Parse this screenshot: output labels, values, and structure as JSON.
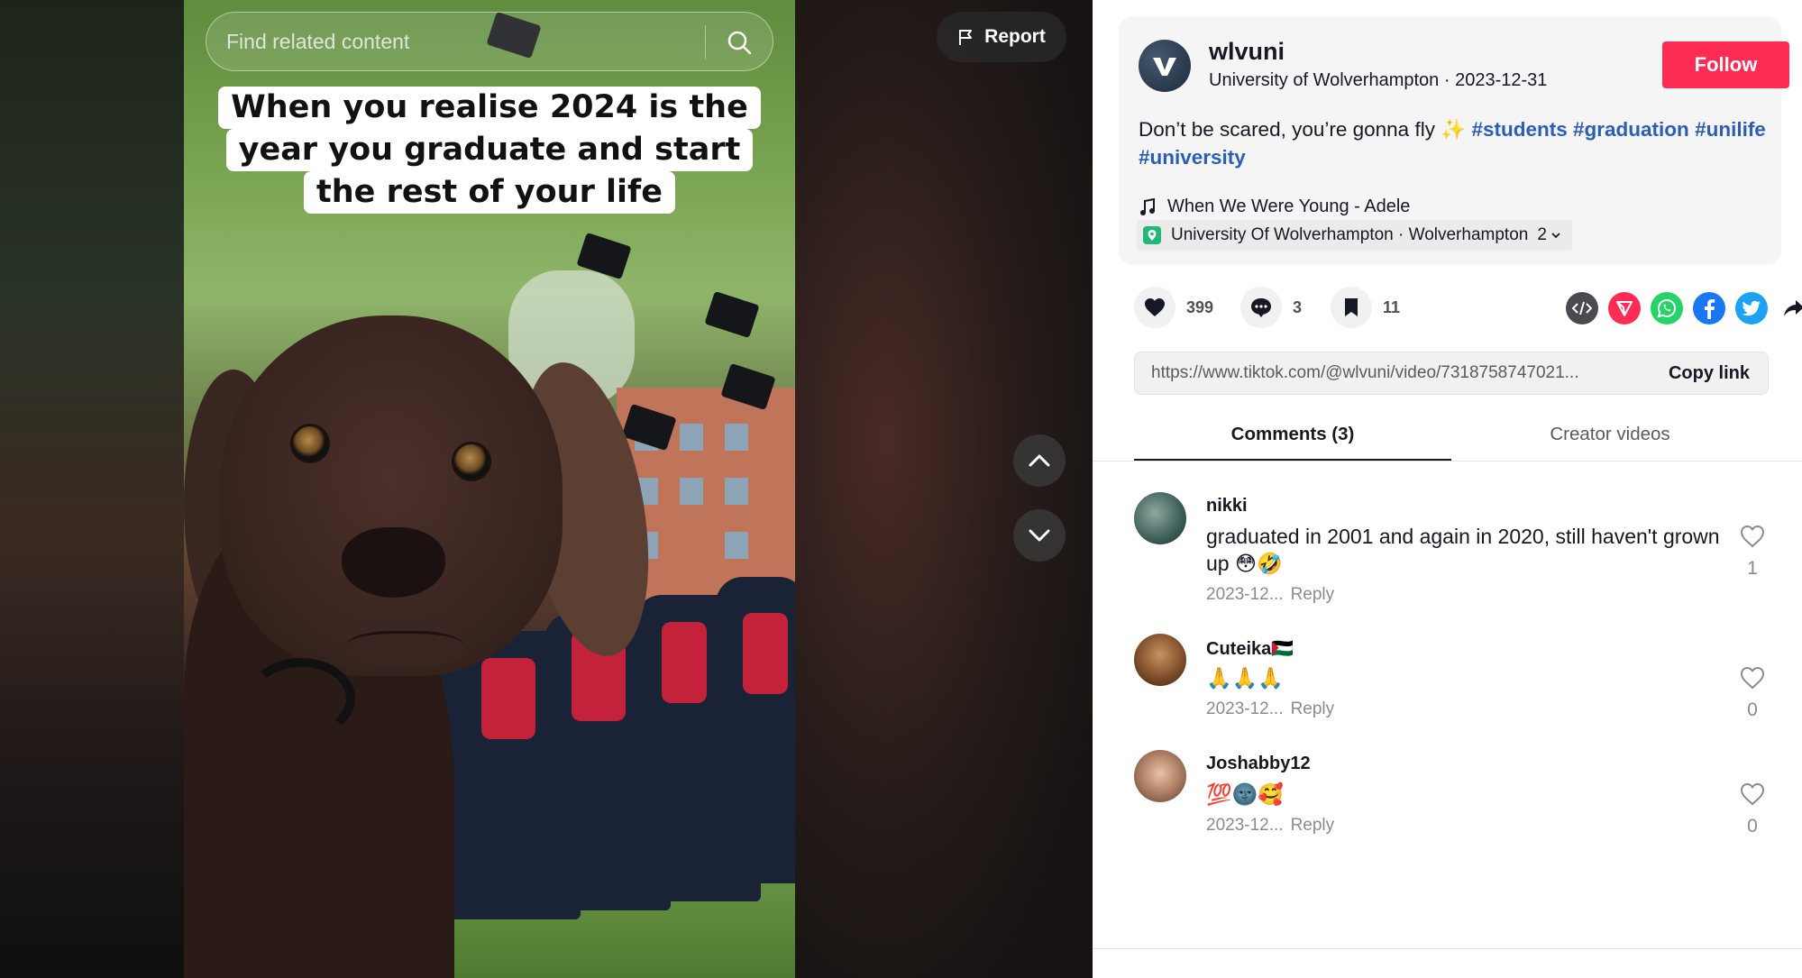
{
  "search": {
    "placeholder": "Find related content"
  },
  "report": {
    "label": "Report"
  },
  "video": {
    "caption_lines": [
      "When you realise 2024 is the",
      "year you graduate and start",
      "the rest of your life"
    ]
  },
  "author": {
    "username": "wlvuni",
    "display_name": "University of Wolverhampton",
    "separator": " · ",
    "date": "2023-12-31",
    "follow_label": "Follow"
  },
  "description": {
    "text": "Don’t be scared, you’re gonna fly ",
    "sparkle": "✨",
    "hashtags": [
      "#students",
      "#graduation",
      "#unilife",
      "#university"
    ]
  },
  "music": {
    "title": "When We Were Young - Adele"
  },
  "location": {
    "name": "University Of Wolverhampton · Wolverhampton",
    "extra_count": "2"
  },
  "actions": {
    "likes": "399",
    "comments": "3",
    "saves": "11",
    "share_icons": [
      "embed-icon",
      "send-icon",
      "whatsapp-icon",
      "facebook-icon",
      "twitter-icon",
      "share-arrow-icon"
    ]
  },
  "link": {
    "url": "https://www.tiktok.com/@wlvuni/video/7318758747021...",
    "copy_label": "Copy link"
  },
  "tabs": [
    {
      "label": "Comments (3)",
      "active": true
    },
    {
      "label": "Creator videos",
      "active": false
    }
  ],
  "comments": [
    {
      "user": "nikki",
      "text": "graduated in 2001 and again in 2020, still haven't grown up 😳🤣",
      "date": "2023-12...",
      "reply": "Reply",
      "likes": "1"
    },
    {
      "user": "Cuteika🇵🇸",
      "text": "🙏🙏🙏",
      "date": "2023-12...",
      "reply": "Reply",
      "likes": "0"
    },
    {
      "user": "Joshabby12",
      "text": "💯🌚🥰",
      "date": "2023-12...",
      "reply": "Reply",
      "likes": "0"
    }
  ],
  "colors": {
    "follow": "#fe2c55",
    "hashtag": "#2b5db9",
    "location_pin": "#20b777"
  }
}
